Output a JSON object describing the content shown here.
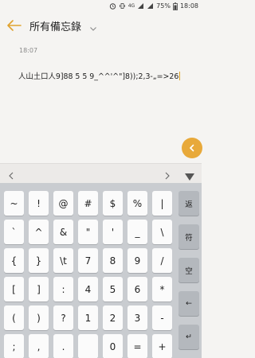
{
  "status_bar": {
    "network": "4G",
    "battery": "75%",
    "time": "18:08"
  },
  "app_bar": {
    "title": "所有備忘錄"
  },
  "note": {
    "timestamp": "18:07",
    "content": "人山土口人9]88 5 5 9_^^'^\"]8));2,3-„=>26"
  },
  "candidate_bar": {
    "left": "<",
    "right": ">"
  },
  "keyboard": {
    "rows": [
      [
        "~",
        "!",
        "@",
        "#",
        "$",
        "%",
        "|"
      ],
      [
        "`",
        "^",
        "&",
        "\"",
        "'",
        "_",
        "\\"
      ],
      [
        "{",
        "}",
        "\\t",
        "7",
        "8",
        "9",
        "/"
      ],
      [
        "[",
        "]",
        ":",
        "4",
        "5",
        "6",
        "*"
      ],
      [
        "(",
        ")",
        "?",
        "1",
        "2",
        "3",
        "-"
      ],
      [
        ";",
        ",",
        ".",
        "",
        "0",
        "=",
        "+"
      ]
    ],
    "function_keys": [
      "返",
      "符",
      "空",
      "←",
      "↵"
    ]
  },
  "colors": {
    "accent": "#e8a93a",
    "keyboard_bg": "#c9ccd0",
    "key_bg": "#fbfbfb",
    "function_key_bg": "#b4b8bd"
  }
}
